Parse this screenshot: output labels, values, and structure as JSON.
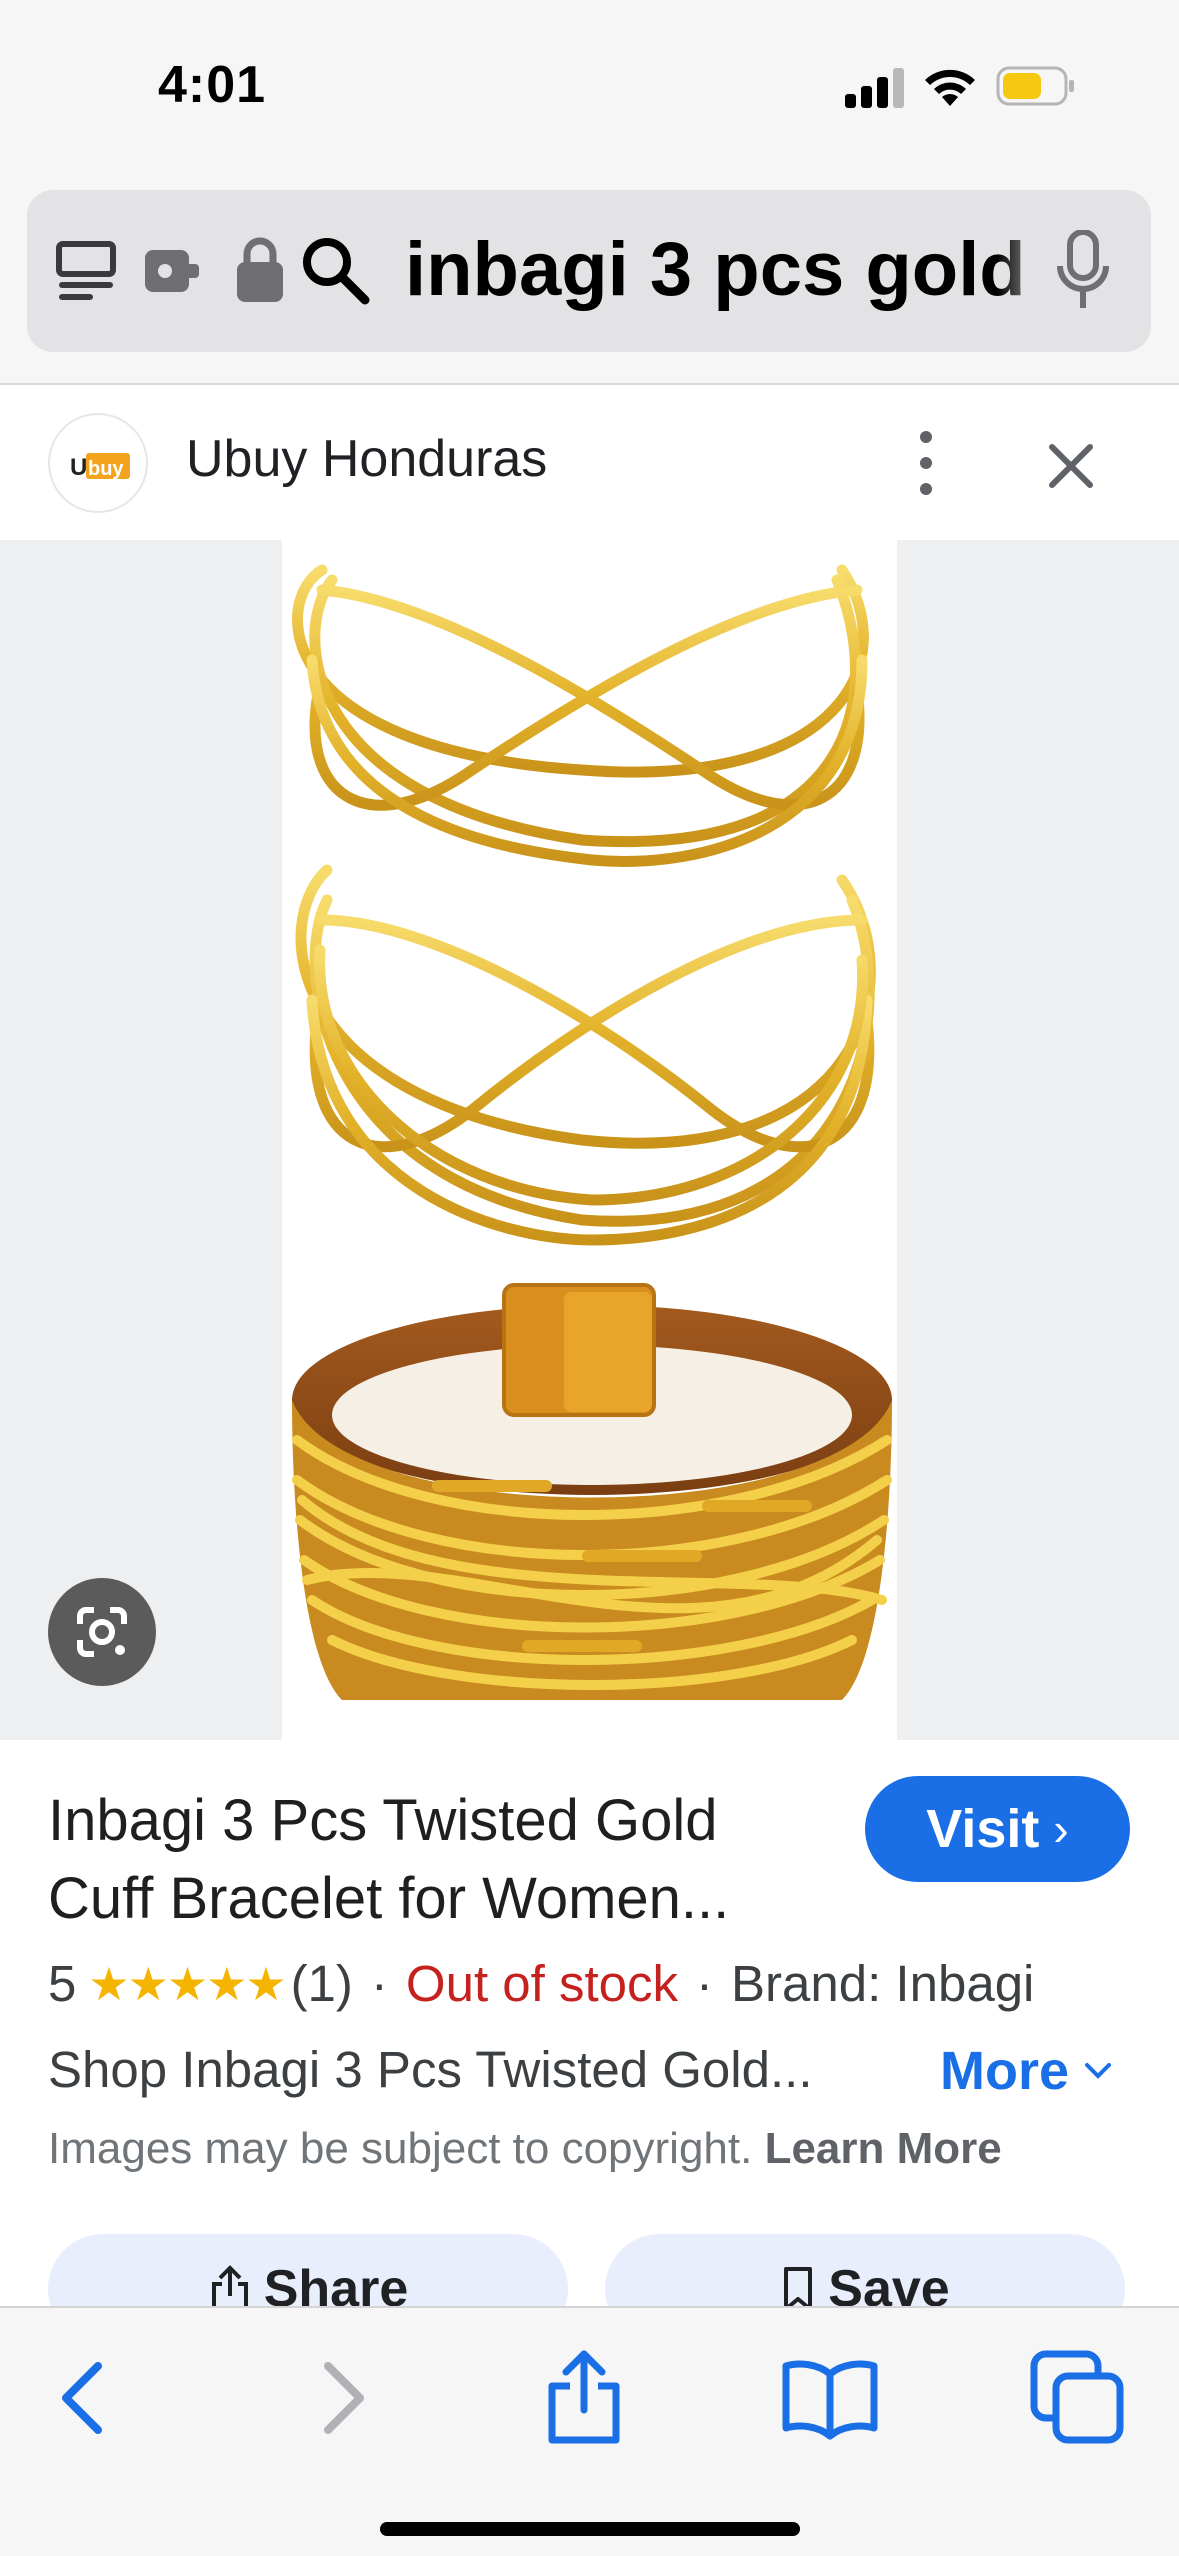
{
  "status_bar": {
    "time": "4:01"
  },
  "address_bar": {
    "url_text": "inbagi 3 pcs gold"
  },
  "site": {
    "name": "Ubuy Honduras",
    "logo_text": "Ubuy"
  },
  "product": {
    "title_line1": "Inbagi 3 Pcs Twisted Gold",
    "title_line2": "Cuff Bracelet for Women...",
    "visit_label": "Visit",
    "rating_value": "5",
    "stars": "★★★★★",
    "rating_count": "(1)",
    "stock_status": "Out of stock",
    "separator": "·",
    "brand": "Brand: Inbagi",
    "description": "Shop Inbagi 3 Pcs Twisted Gold...",
    "more_label": "More",
    "copyright_text": "Images may be subject to copyright.",
    "learn_more_label": "Learn More",
    "share_label": "Share",
    "save_label": "Save"
  },
  "colors": {
    "accent": "#1a6fe6",
    "out_of_stock": "#c5221f",
    "star": "#f4b400",
    "gold": "#e8b928"
  },
  "icons": {
    "reader": "reader-icon",
    "extension": "extension-icon",
    "lock": "lock-icon",
    "search": "search-icon",
    "mic": "microphone-icon",
    "lens": "google-lens-icon",
    "back": "back-arrow-icon",
    "forward": "forward-arrow-icon",
    "share": "share-icon",
    "bookmarks": "bookmarks-icon",
    "tabs": "tabs-icon"
  }
}
